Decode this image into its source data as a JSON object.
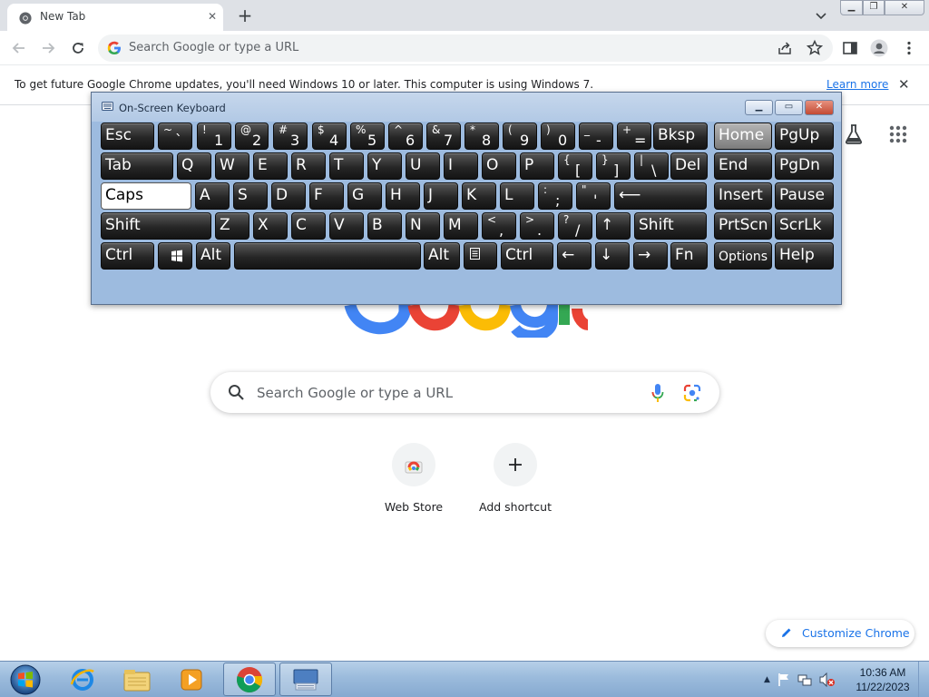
{
  "browser": {
    "tab": {
      "title": "New Tab",
      "favicon": "chrome-icon"
    },
    "omnibox": {
      "placeholder": "Search Google or type a URL"
    },
    "infobar": {
      "message": "To get future Google Chrome updates, you'll need Windows 10 or later. This computer is using Windows 7.",
      "link": "Learn more"
    }
  },
  "ntp": {
    "search_placeholder": "Search Google or type a URL",
    "shortcuts": [
      {
        "label": "Web Store",
        "icon": "webstore-icon"
      },
      {
        "label": "Add shortcut",
        "icon": "plus-icon"
      }
    ],
    "customize_label": "Customize Chrome"
  },
  "osk": {
    "title": "On-Screen Keyboard",
    "rows": [
      [
        {
          "label": "Esc"
        },
        {
          "top": "~",
          "bottom": "`"
        },
        {
          "top": "!",
          "bottom": "1"
        },
        {
          "top": "@",
          "bottom": "2"
        },
        {
          "top": "#",
          "bottom": "3"
        },
        {
          "top": "$",
          "bottom": "4"
        },
        {
          "top": "%",
          "bottom": "5"
        },
        {
          "top": "^",
          "bottom": "6"
        },
        {
          "top": "&",
          "bottom": "7"
        },
        {
          "top": "*",
          "bottom": "8"
        },
        {
          "top": "(",
          "bottom": "9"
        },
        {
          "top": ")",
          "bottom": "0"
        },
        {
          "top": "_",
          "bottom": "-"
        },
        {
          "top": "+",
          "bottom": "="
        },
        {
          "label": "Bksp"
        },
        {
          "label": "Home"
        },
        {
          "label": "PgUp"
        }
      ],
      [
        {
          "label": "Tab"
        },
        {
          "label": "Q"
        },
        {
          "label": "W"
        },
        {
          "label": "E"
        },
        {
          "label": "R"
        },
        {
          "label": "T"
        },
        {
          "label": "Y"
        },
        {
          "label": "U"
        },
        {
          "label": "I"
        },
        {
          "label": "O"
        },
        {
          "label": "P"
        },
        {
          "top": "{",
          "bottom": "["
        },
        {
          "top": "}",
          "bottom": "]"
        },
        {
          "top": "|",
          "bottom": "\\"
        },
        {
          "label": "Del"
        },
        {
          "label": "End"
        },
        {
          "label": "PgDn"
        }
      ],
      [
        {
          "label": "Caps"
        },
        {
          "label": "A"
        },
        {
          "label": "S"
        },
        {
          "label": "D"
        },
        {
          "label": "F"
        },
        {
          "label": "G"
        },
        {
          "label": "H"
        },
        {
          "label": "J"
        },
        {
          "label": "K"
        },
        {
          "label": "L"
        },
        {
          "top": ":",
          "bottom": ";"
        },
        {
          "top": "\"",
          "bottom": "'"
        },
        {
          "label": "⟵"
        },
        {
          "label": "Insert"
        },
        {
          "label": "Pause"
        }
      ],
      [
        {
          "label": "Shift"
        },
        {
          "label": "Z"
        },
        {
          "label": "X"
        },
        {
          "label": "C"
        },
        {
          "label": "V"
        },
        {
          "label": "B"
        },
        {
          "label": "N"
        },
        {
          "label": "M"
        },
        {
          "top": "<",
          "bottom": ","
        },
        {
          "top": ">",
          "bottom": "."
        },
        {
          "top": "?",
          "bottom": "/"
        },
        {
          "label": "↑"
        },
        {
          "label": "Shift"
        },
        {
          "label": "PrtScn"
        },
        {
          "label": "ScrLk"
        }
      ],
      [
        {
          "label": "Ctrl"
        },
        {
          "label": "",
          "icon": "windows-logo-icon"
        },
        {
          "label": "Alt"
        },
        {
          "label": ""
        },
        {
          "label": "Alt"
        },
        {
          "label": "",
          "icon": "menu-key-icon"
        },
        {
          "label": "Ctrl"
        },
        {
          "label": "←"
        },
        {
          "label": "↓"
        },
        {
          "label": "→"
        },
        {
          "label": "Fn"
        },
        {
          "label": "Options"
        },
        {
          "label": "Help"
        }
      ]
    ]
  },
  "taskbar": {
    "items": [
      "ie-icon",
      "explorer-icon",
      "media-player-icon",
      "chrome-icon",
      "osk-icon"
    ],
    "clock": {
      "time": "10:36 AM",
      "date": "11/22/2023"
    }
  }
}
